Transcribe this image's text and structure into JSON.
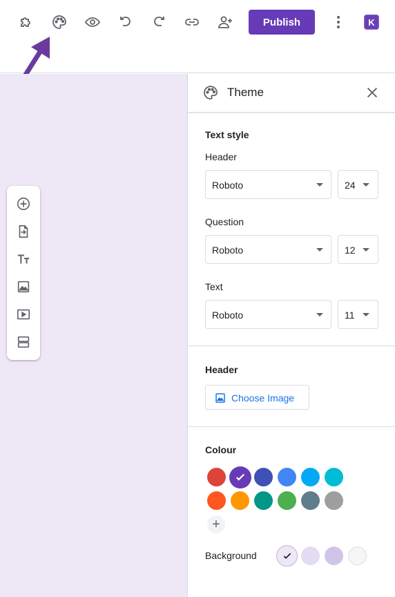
{
  "toolbar": {
    "icons": [
      "puzzle-icon",
      "palette-icon",
      "eye-icon",
      "undo-icon",
      "redo-icon",
      "link-icon",
      "add-person-icon",
      "more-vert-icon"
    ],
    "publish_label": "Publish",
    "avatar_letter": "K",
    "accent": "#673ab7"
  },
  "side_toolbar": {
    "icons": [
      "add-circle-icon",
      "import-icon",
      "title-icon",
      "image-icon",
      "video-icon",
      "section-icon"
    ]
  },
  "theme_panel": {
    "title": "Theme",
    "text_style": {
      "title": "Text style",
      "rows": [
        {
          "label": "Header",
          "font": "Roboto",
          "size": "24"
        },
        {
          "label": "Question",
          "font": "Roboto",
          "size": "12"
        },
        {
          "label": "Text",
          "font": "Roboto",
          "size": "11"
        }
      ]
    },
    "header": {
      "title": "Header",
      "choose_image_label": "Choose Image"
    },
    "colour": {
      "title": "Colour",
      "swatches": [
        "#db4437",
        "#673ab7",
        "#3f51b5",
        "#4285f4",
        "#03a9f4",
        "#00bcd4",
        "#ff5722",
        "#ff9800",
        "#009688",
        "#4caf50",
        "#607d8b",
        "#9e9e9e"
      ],
      "selected": "#673ab7",
      "add_label": "+"
    },
    "background": {
      "label": "Background",
      "swatches": [
        "#ede7f6",
        "#e3dcf3",
        "#d1c4e9",
        "#f6f6f6"
      ],
      "selected": "#ede7f6"
    }
  }
}
